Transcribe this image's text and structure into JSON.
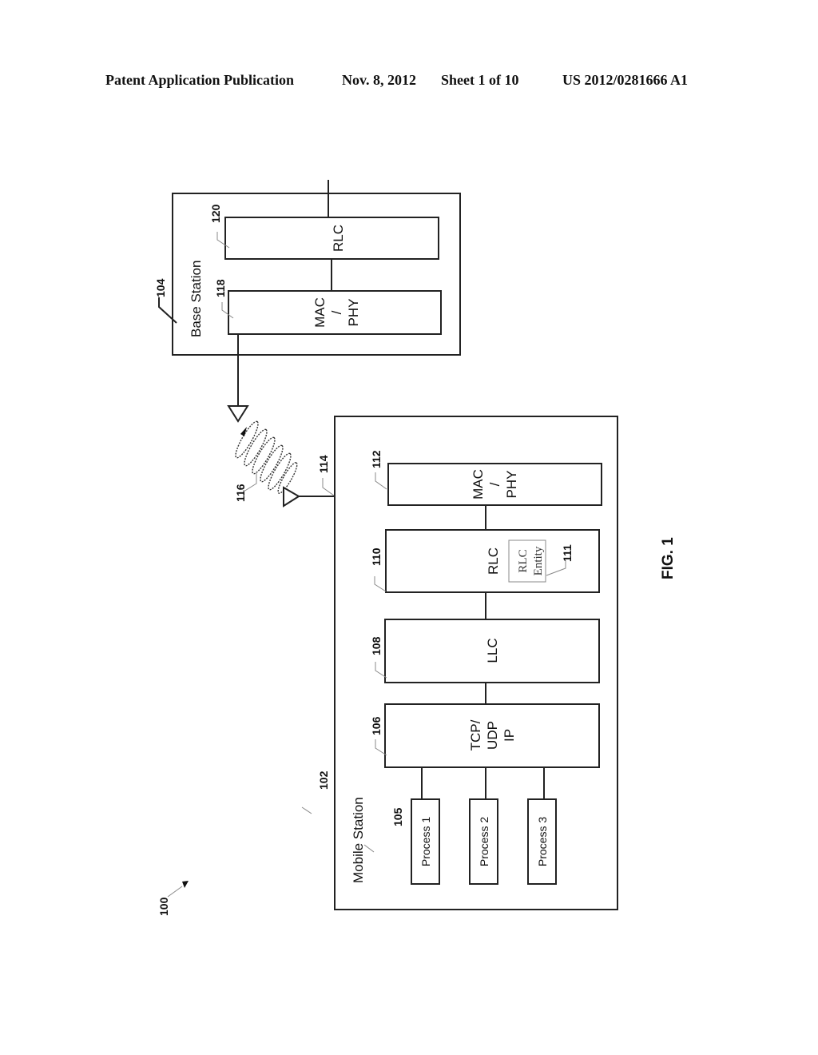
{
  "header": {
    "publication": "Patent Application Publication",
    "date": "Nov. 8, 2012",
    "sheet": "Sheet 1 of 10",
    "number": "US 2012/0281666 A1"
  },
  "figure": {
    "caption": "FIG. 1",
    "system_ref": "100",
    "base_station": {
      "ref": "104",
      "label": "Base Station",
      "rlc": {
        "ref": "120",
        "label": "RLC"
      },
      "mac_phy": {
        "ref": "118",
        "line1": "MAC",
        "line2": "/",
        "line3": "PHY"
      }
    },
    "wireless_link_ref": "116",
    "antenna_ref": "114",
    "mobile_station": {
      "ref": "102",
      "label": "Mobile Station",
      "mac_phy": {
        "ref": "112",
        "line1": "MAC",
        "line2": "/",
        "line3": "PHY"
      },
      "rlc": {
        "ref": "110",
        "label": "RLC"
      },
      "rlc_entity": {
        "ref": "111",
        "line1": "RLC",
        "line2": "Entity"
      },
      "llc": {
        "ref": "108",
        "label": "LLC"
      },
      "tcp_ip": {
        "ref": "106",
        "line1": "TCP/",
        "line2": "UDP",
        "line3": "IP"
      },
      "processes_ref": "105",
      "processes": [
        "Process 1",
        "Process 2",
        "Process 3"
      ]
    }
  }
}
